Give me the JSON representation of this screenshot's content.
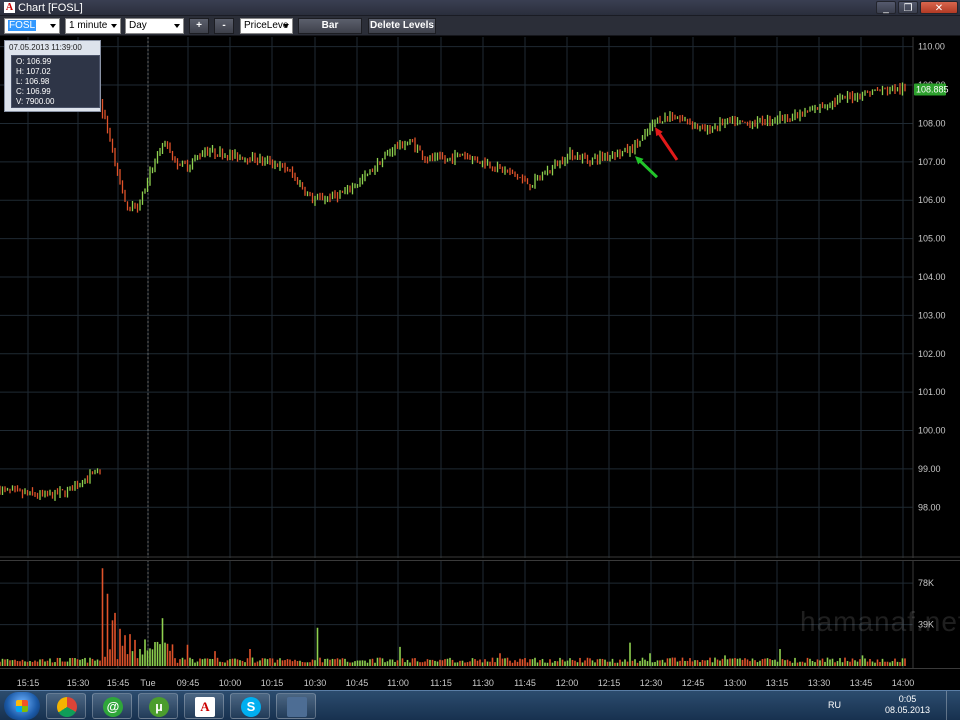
{
  "window": {
    "title": "Chart [FOSL]",
    "minimize": "_",
    "maximize": "❐",
    "close": "✕"
  },
  "toolbar": {
    "symbol": "FOSL",
    "interval": "1 minute",
    "period": "Day",
    "plus_label": "+",
    "minus_label": "-",
    "tool": "PriceLeve",
    "chart_type_label": "Bar",
    "delete_levels_label": "Delete Levels"
  },
  "tooltip": {
    "datetime": "07.05.2013 11:39:00",
    "open": "O: 106.99",
    "high": "H: 107.02",
    "low": "L: 106.98",
    "close": "C: 106.99",
    "volume": "V: 7900.00"
  },
  "current_price": "108.885",
  "colors": {
    "up": "#8fd14f",
    "down": "#e0532a",
    "grid": "#1f2a33",
    "axis_text": "#c8c8c8",
    "price_badge": "#2da02d",
    "arrow_green": "#22c42a",
    "arrow_red": "#e21a1a"
  },
  "watermark": "hamanaf.net",
  "taskbar": {
    "icons": [
      "chrome-icon",
      "at-icon",
      "utorrent-icon",
      "a-icon",
      "skype-icon",
      "window-icon"
    ],
    "lang": "RU",
    "time": "0:05",
    "date": "08.05.2013"
  },
  "chart_data": {
    "type": "bar",
    "price_axis_labels": [
      "110.00",
      "109.00",
      "108.00",
      "107.00",
      "106.00",
      "105.00",
      "104.00",
      "103.00",
      "102.00",
      "101.00",
      "100.00",
      "99.00",
      "98.00"
    ],
    "volume_axis_labels": [
      "78K",
      "39K"
    ],
    "time_labels": [
      "15:15",
      "15:30",
      "15:45",
      "Tue",
      "09:45",
      "10:00",
      "10:15",
      "10:30",
      "10:45",
      "11:00",
      "11:15",
      "11:30",
      "11:45",
      "12:00",
      "12:15",
      "12:30",
      "12:45",
      "13:00",
      "13:15",
      "13:30",
      "13:45",
      "14:00"
    ],
    "price_ylim": [
      97.2,
      110.2
    ],
    "volume_ylim": [
      0,
      96000
    ],
    "session_break_index": 40,
    "anchors": [
      [
        0,
        98.45
      ],
      [
        10,
        98.35
      ],
      [
        20,
        98.3
      ],
      [
        28,
        98.45
      ],
      [
        35,
        98.8
      ],
      [
        40,
        98.9
      ],
      [
        41,
        108.3
      ],
      [
        44,
        107.6
      ],
      [
        50,
        105.9
      ],
      [
        55,
        105.8
      ],
      [
        60,
        106.7
      ],
      [
        66,
        107.5
      ],
      [
        70,
        107.0
      ],
      [
        75,
        106.9
      ],
      [
        82,
        107.3
      ],
      [
        90,
        107.2
      ],
      [
        100,
        107.1
      ],
      [
        108,
        107.0
      ],
      [
        115,
        106.8
      ],
      [
        120,
        106.4
      ],
      [
        125,
        106.0
      ],
      [
        130,
        106.05
      ],
      [
        138,
        106.2
      ],
      [
        146,
        106.6
      ],
      [
        152,
        107.0
      ],
      [
        158,
        107.4
      ],
      [
        165,
        107.5
      ],
      [
        170,
        107.1
      ],
      [
        178,
        107.05
      ],
      [
        185,
        107.2
      ],
      [
        195,
        106.95
      ],
      [
        205,
        106.7
      ],
      [
        212,
        106.4
      ],
      [
        220,
        106.8
      ],
      [
        228,
        107.2
      ],
      [
        235,
        107.05
      ],
      [
        245,
        107.2
      ],
      [
        252,
        107.3
      ],
      [
        257,
        107.6
      ],
      [
        262,
        108.05
      ],
      [
        268,
        108.2
      ],
      [
        276,
        108.05
      ],
      [
        282,
        107.8
      ],
      [
        290,
        108.05
      ],
      [
        300,
        108.0
      ],
      [
        312,
        108.15
      ],
      [
        320,
        108.2
      ],
      [
        330,
        108.5
      ],
      [
        340,
        108.7
      ],
      [
        350,
        108.85
      ],
      [
        358,
        108.9
      ],
      [
        362,
        108.88
      ]
    ],
    "volume_spikes": [
      [
        41,
        92000
      ],
      [
        43,
        68000
      ],
      [
        45,
        43000
      ],
      [
        46,
        50000
      ],
      [
        48,
        35000
      ],
      [
        50,
        29000
      ],
      [
        52,
        30000
      ],
      [
        58,
        25000
      ],
      [
        65,
        45000
      ],
      [
        75,
        20000
      ],
      [
        86,
        14000
      ],
      [
        100,
        16000
      ],
      [
        127,
        36000
      ],
      [
        160,
        18000
      ],
      [
        200,
        12000
      ],
      [
        252,
        22000
      ],
      [
        260,
        12000
      ],
      [
        290,
        10000
      ],
      [
        312,
        16000
      ],
      [
        345,
        10000
      ]
    ],
    "markers": [
      {
        "color": "green",
        "tip_index": 254,
        "tip_price": 107.15,
        "from_price": 106.6
      },
      {
        "color": "red",
        "tip_index": 262,
        "tip_price": 107.9,
        "from_price": 107.05
      }
    ]
  }
}
